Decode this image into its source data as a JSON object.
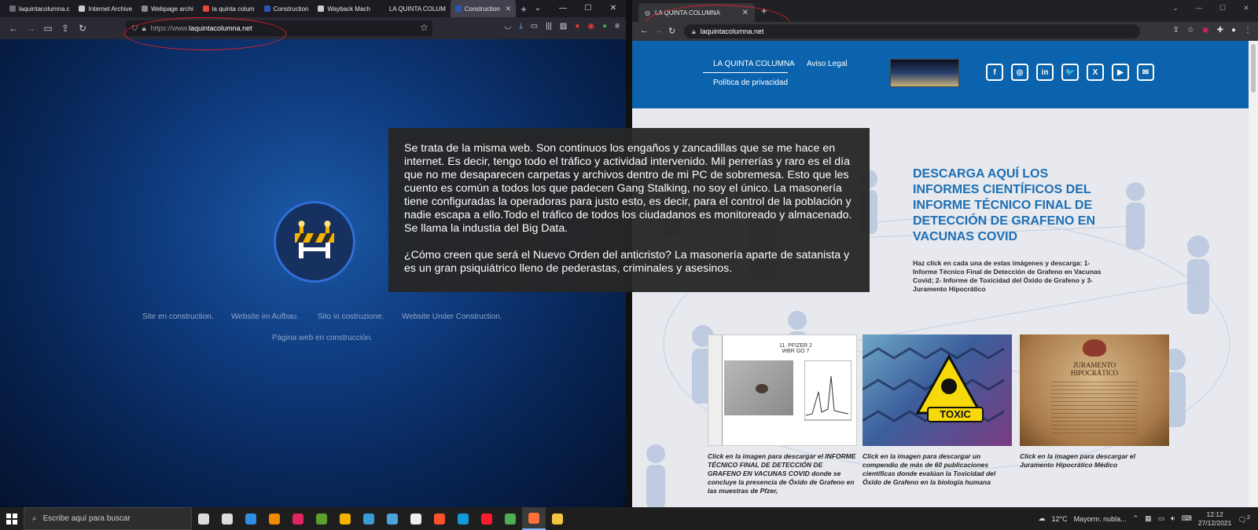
{
  "left_browser": {
    "tabs": [
      {
        "label": "laquintacolumna.c",
        "icon": "firefox-generic-icon",
        "color": "#6b6b7a"
      },
      {
        "label": "Internet Archive",
        "icon": "archive-icon",
        "color": "#cccccc"
      },
      {
        "label": "Webpage archi",
        "icon": "webpage-archive-icon",
        "color": "#8a8a8a"
      },
      {
        "label": "la quinta colum",
        "icon": "google-icon",
        "color": "#e8453c"
      },
      {
        "label": "Construction",
        "icon": "construction-site-icon",
        "color": "#2856b6"
      },
      {
        "label": "Wayback Mach",
        "icon": "wayback-icon",
        "color": "#cccccc"
      },
      {
        "label": "LA QUINTA COLUM",
        "icon": "",
        "color": "#1c1b22"
      },
      {
        "label": "Construction",
        "icon": "construction-site-icon",
        "color": "#2856b6",
        "active": true
      }
    ],
    "url_prefix": "https://www.",
    "url_domain": "laquintacolumna.net",
    "page": {
      "languages": [
        "Site en construction.",
        "Website im Aufbau.",
        "Sito in costruzione.",
        "Website Under Construction."
      ],
      "spanish": "Página web en construcción."
    }
  },
  "right_browser": {
    "tab_title": "LA QUINTA COLUMNA",
    "url": "laquintacolumna.net",
    "site": {
      "nav": [
        "LA QUINTA COLUMNA",
        "Aviso Legal",
        "Política de privacidad"
      ],
      "social": [
        {
          "icon": "facebook-icon",
          "glyph": "f"
        },
        {
          "icon": "instagram-icon",
          "glyph": "◎"
        },
        {
          "icon": "linkedin-icon",
          "glyph": "in"
        },
        {
          "icon": "twitter-icon",
          "glyph": "🐦"
        },
        {
          "icon": "xing-icon",
          "glyph": "X"
        },
        {
          "icon": "youtube-icon",
          "glyph": "▶"
        },
        {
          "icon": "email-icon",
          "glyph": "✉"
        }
      ],
      "headline": "DESCARGA AQUÍ LOS INFORMES CIENTÍFICOS DEL INFORME TÉCNICO FINAL DE DETECCIÓN DE GRAFENO EN VACUNAS COVID",
      "subtext": "Haz click en cada una de estas imágenes y descarga: 1- Informe Técnico Final de Detección de Grafeno en Vacunas Covid; 2- Informe de Toxicidad del Óxido de Grafeno y 3- Juramento Hipocrático",
      "thumbs": [
        {
          "title_line1": "11. PFIZER 2",
          "title_line2": "WBR GO 7",
          "caption": "Click en la imagen para descargar el INFORME TÉCNICO FINAL DE DETECCIÓN DE GRAFENO EN VACUNAS COVID donde se concluye la presencia de Óxido de Grafeno en las muestras de Pfzer,"
        },
        {
          "label": "TOXIC",
          "caption": "Click en la imagen para descargar un compendio de más de 60 publicaciones científicas donde evalúan la Toxicidad del Óxido de Grafeno en la biología humana"
        },
        {
          "label": "JURAMENTO HIPOCRÁTICO",
          "caption": "Click en la imagen para descargar el Juramento Hipocrático Médico"
        }
      ]
    }
  },
  "overlay": {
    "paragraph1": "Se trata de la misma web. Son continuos los engaños y zancadillas que se me hace en internet. Es decir, tengo todo el tráfico y actividad intervenido. Mil perrerías y raro es el día que no me desaparecen carpetas y archivos dentro de mi PC de sobremesa. Esto que les cuento es común a todos los que padecen Gang Stalking, no soy el único. La masonería tiene configuradas la operadoras para justo esto, es decir, para el control de la población y nadie escapa a ello.Todo el tráfico de todos los ciudadanos es monitoreado y almacenado. Se llama la industia del Big Data.",
    "paragraph2": "¿Cómo creen que será el Nuevo Orden del anticristo? La masonería aparte de satanista y es un gran psiquiátrico lleno de pederastas, criminales y asesinos."
  },
  "taskbar": {
    "search_placeholder": "Escribe aquí para buscar",
    "apps": [
      {
        "icon": "task-view-icon",
        "color": "#dddddd"
      },
      {
        "icon": "timeline-icon",
        "color": "#dddddd"
      },
      {
        "icon": "browser-app-icon",
        "color": "#2f8fe0"
      },
      {
        "icon": "vlc-icon",
        "color": "#f08a00"
      },
      {
        "icon": "app-red-icon",
        "color": "#e0245e"
      },
      {
        "icon": "app-green-icon",
        "color": "#5aa02c"
      },
      {
        "icon": "chrome-canary-icon",
        "color": "#f2b400"
      },
      {
        "icon": "app-bird-icon",
        "color": "#3a9bd5"
      },
      {
        "icon": "notepad-icon",
        "color": "#4aa3df"
      },
      {
        "icon": "file-icon",
        "color": "#eeeeee"
      },
      {
        "icon": "brave-icon",
        "color": "#fb542b"
      },
      {
        "icon": "edge-icon",
        "color": "#0f9ad8"
      },
      {
        "icon": "opera-icon",
        "color": "#ff1b2d"
      },
      {
        "icon": "chrome-icon",
        "color": "#4caf50"
      },
      {
        "icon": "firefox-icon",
        "color": "#ff7139",
        "active": true
      },
      {
        "icon": "explorer-icon",
        "color": "#f4c542"
      }
    ],
    "weather": "12°C",
    "weather_desc": "Mayorm. nubla...",
    "time": "12:12",
    "date": "27/12/2021",
    "notifications": "2"
  }
}
